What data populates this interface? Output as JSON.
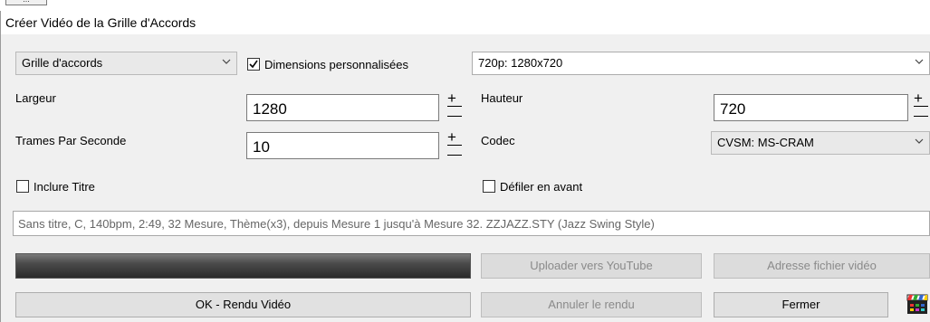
{
  "window": {
    "title": "Créer Vidéo de la Grille d'Accords",
    "top_stub_label": "..."
  },
  "row1": {
    "mode_select": "Grille d'accords",
    "custom_dims_label": "Dimensions personnalisées",
    "custom_dims_checked": true,
    "resolution_select": "720p: 1280x720"
  },
  "row2": {
    "width_label": "Largeur",
    "width_value": "1280",
    "height_label": "Hauteur",
    "height_value": "720"
  },
  "row3": {
    "fps_label": "Trames Par Seconde",
    "fps_value": "10",
    "codec_label": "Codec",
    "codec_select": "CVSM: MS-CRAM"
  },
  "row4": {
    "include_title_label": "Inclure Titre",
    "include_title_checked": false,
    "scroll_ahead_label": "Défiler en avant",
    "scroll_ahead_checked": false
  },
  "summary": "Sans titre, C, 140bpm, 2:49, 32 Mesure, Thème(x3), depuis Mesure 1 jusqu'à Mesure 32. ZZJAZZ.STY (Jazz Swing Style)",
  "buttons": {
    "upload_youtube": "Uploader vers YouTube",
    "video_file_address": "Adresse fichier vidéo",
    "ok_render": "OK - Rendu Vidéo",
    "cancel_render": "Annuler le rendu",
    "close": "Fermer"
  },
  "icons": {
    "clapperboard": "clapperboard-icon"
  }
}
